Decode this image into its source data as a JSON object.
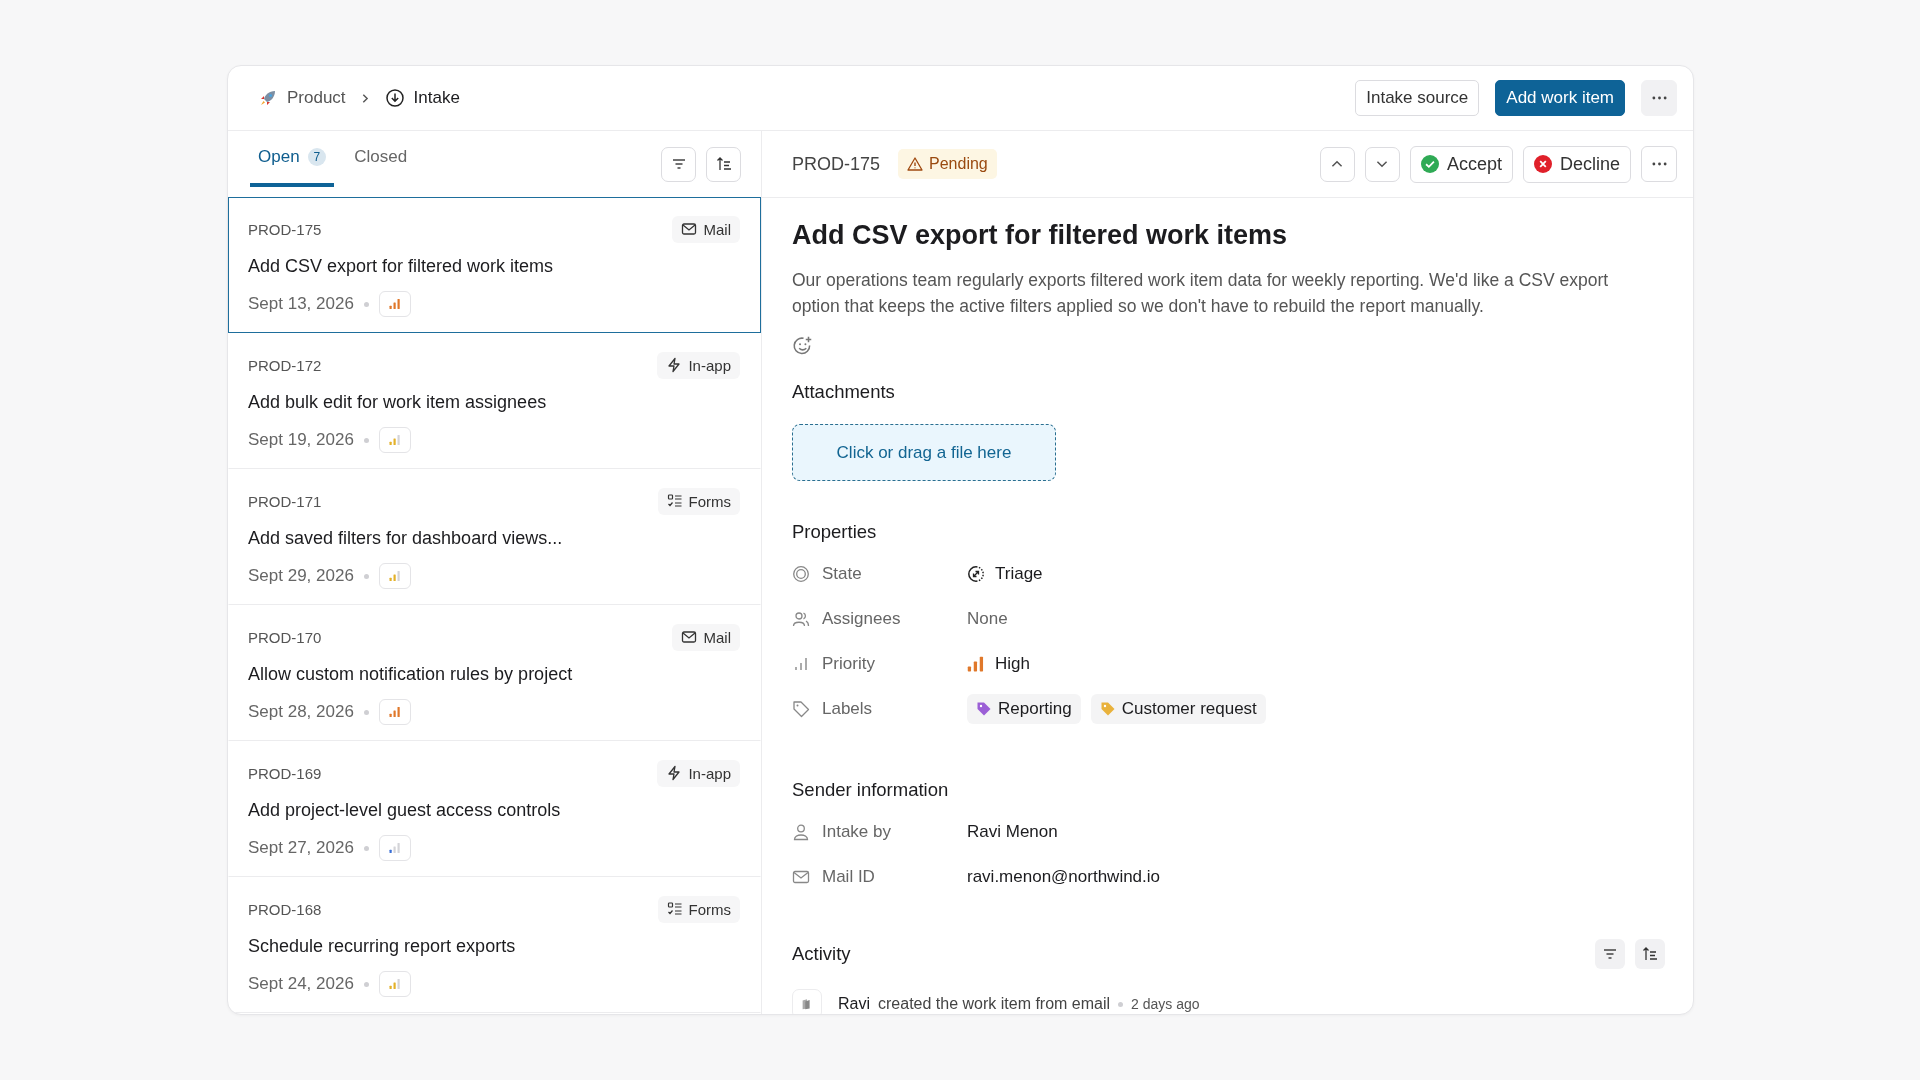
{
  "breadcrumb": [
    {
      "label": "Product",
      "kind": "project"
    },
    {
      "label": "Intake",
      "kind": "intake"
    }
  ],
  "header_actions": [
    {
      "label": "Intake source",
      "kind": "outline"
    },
    {
      "label": "Add work item",
      "kind": "primary"
    }
  ],
  "tabs": [
    {
      "label": "Open",
      "count": "7",
      "selected": true
    },
    {
      "label": "Closed",
      "selected": false
    }
  ],
  "items": [
    {
      "id": "PROD-175",
      "source": {
        "label": "Mail",
        "kind": "mail"
      },
      "title": "Add CSV export for filtered work items",
      "date": "Sept 13, 2026",
      "priority": {
        "kind": "high"
      },
      "selected": true
    },
    {
      "id": "PROD-172",
      "source": {
        "label": "In-app",
        "kind": "app"
      },
      "title": "Add bulk edit for work item assignees",
      "date": "Sept 19, 2026",
      "priority": {
        "kind": "medium"
      },
      "selected": false
    },
    {
      "id": "PROD-171",
      "source": {
        "label": "Forms",
        "kind": "forms"
      },
      "title": "Add saved filters for dashboard views...",
      "date": "Sept 29, 2026",
      "priority": {
        "kind": "medium"
      },
      "selected": false
    },
    {
      "id": "PROD-170",
      "source": {
        "label": "Mail",
        "kind": "mail"
      },
      "title": "Allow custom notification rules by project",
      "date": "Sept 28, 2026",
      "priority": {
        "kind": "high"
      },
      "selected": false
    },
    {
      "id": "PROD-169",
      "source": {
        "label": "In-app",
        "kind": "app"
      },
      "title": "Add project-level guest access controls",
      "date": "Sept 27, 2026",
      "priority": {
        "kind": "low"
      },
      "selected": false
    },
    {
      "id": "PROD-168",
      "source": {
        "label": "Forms",
        "kind": "forms"
      },
      "title": "Schedule recurring report exports",
      "date": "Sept 24, 2026",
      "priority": {
        "kind": "medium"
      },
      "selected": false
    }
  ],
  "detail": {
    "id": "PROD-175",
    "status": "Pending",
    "actions": [
      {
        "label": "Accept",
        "kind": "accept"
      },
      {
        "label": "Decline",
        "kind": "decline"
      }
    ],
    "title": "Add CSV export for filtered work items",
    "description": "Our operations team regularly exports filtered work item data for weekly reporting. We'd like a CSV export option that keeps the active filters applied so we don't have to rebuild the report manually.",
    "attachments": {
      "heading": "Attachments",
      "dropzone": "Click or drag a file here"
    },
    "properties": {
      "heading": "Properties",
      "rows": [
        {
          "label": "State",
          "kind": "state",
          "value": "Triage",
          "empty": false
        },
        {
          "label": "Assignees",
          "kind": "assignees",
          "value": "None",
          "empty": true
        },
        {
          "label": "Priority",
          "kind": "priority",
          "value": "High",
          "priority": {
            "kind": "high"
          },
          "empty": false
        },
        {
          "label": "Labels",
          "kind": "labels",
          "labels": [
            {
              "name": "Reporting",
              "color": "#9b5fd6"
            },
            {
              "name": "Customer request",
              "color": "#e9b23c"
            }
          ]
        }
      ]
    },
    "sender": {
      "heading": "Sender information",
      "rows": [
        {
          "label": "Intake by",
          "kind": "person",
          "value": "Ravi Menon"
        },
        {
          "label": "Mail ID",
          "kind": "mail",
          "value": "ravi.menon@northwind.io"
        }
      ]
    },
    "activity": {
      "heading": "Activity",
      "entries": [
        {
          "actor": "Ravi",
          "action": "created the work item from email",
          "time": "2 days ago"
        }
      ]
    }
  }
}
